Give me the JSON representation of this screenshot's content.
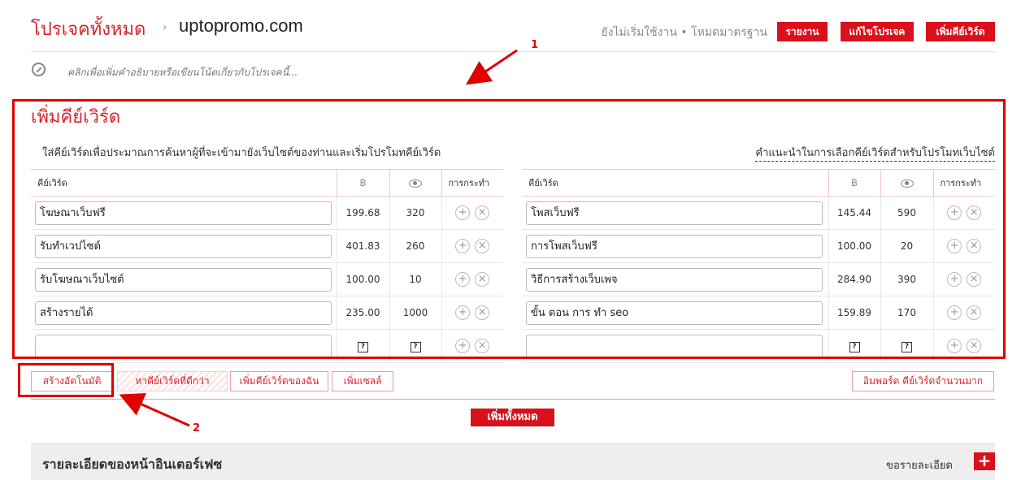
{
  "header": {
    "title": "โปรเจคทั้งหมด",
    "separator": "›",
    "domain": "uptopromo.com",
    "status": "ยังไม่เริ่มใช้งาน • โหมดมาตรฐาน",
    "buttons": [
      "รายงาน",
      "แก้ไขโปรเจค",
      "เพิ่มคีย์เวิร์ด"
    ]
  },
  "description": {
    "icon": "edit-icon",
    "text": "คลิกเพื่อเพิ่มคำอธิบายหรือเขียนโน้ตเกี่ยวกับโปรเจคนี้..."
  },
  "annotations": [
    "1",
    "2"
  ],
  "section": {
    "title": "เพิ่มคีย์เวิร์ด",
    "intro": "ใส่คีย์เวิร์ดเพื่อประมาณการค้นหาผู้ที่จะเข้ามายังเว็บไซต์ของท่านและเริ่มโปรโมทคีย์เวิร์ด",
    "tips_link": "คำแนะนำในการเลือกคีย์เวิร์ดสำหรับโปรโมทเว็บไซต์"
  },
  "table_headers": {
    "keyword": "คีย์เวิร์ด",
    "price": "฿",
    "views_icon": "eye-icon",
    "action": "การกระทำ"
  },
  "left_rows": [
    {
      "keyword": "โฆษณาเว็บฟรี",
      "price": "199.68",
      "views": "320"
    },
    {
      "keyword": "รับทำเวปไซต์",
      "price": "401.83",
      "views": "260"
    },
    {
      "keyword": "รับโฆษณาเว็บไซต์",
      "price": "100.00",
      "views": "10"
    },
    {
      "keyword": "สร้างรายได้",
      "price": "235.00",
      "views": "1000"
    }
  ],
  "right_rows": [
    {
      "keyword": "โพสเว็บฟรี",
      "price": "145.44",
      "views": "590"
    },
    {
      "keyword": "การโพสเว็บฟรี",
      "price": "100.00",
      "views": "20"
    },
    {
      "keyword": "วิธีการสร้างเว็บเพจ",
      "price": "284.90",
      "views": "390"
    },
    {
      "keyword": "ขั้น ตอน การ ทำ seo",
      "price": "159.89",
      "views": "170"
    }
  ],
  "empty_marker": "?",
  "action_icons": {
    "add": "+",
    "remove": "×"
  },
  "tool_buttons": {
    "auto": "สร้างอัตโนมัติ",
    "better": "หาคีย์เวิร์ดที่ดีกว่า",
    "mine": "เพิ่มคีย์เวิร์ดของฉัน",
    "sells": "เพิ่มเซลล์",
    "import": "อิมพอร์ต คีย์เวิร์ดจำนวนมาก"
  },
  "add_all": "เพิ่มทั้งหมด",
  "interface": {
    "title": "รายละเอียดของหน้าอินเตอร์เฟซ",
    "request": "ขอรายละเอียด",
    "plus": "+"
  }
}
